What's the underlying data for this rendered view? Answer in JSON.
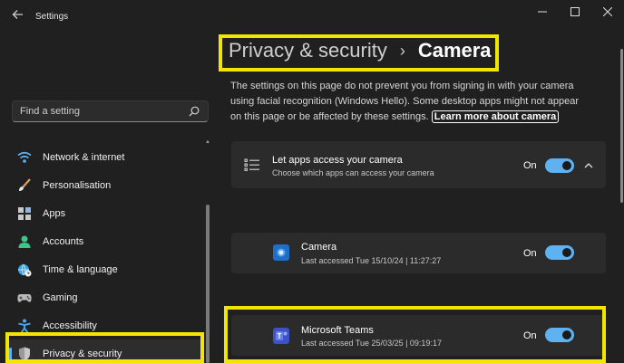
{
  "window": {
    "title": "Settings",
    "controls": {
      "minimize": "—",
      "maximize": "☐",
      "close": "✕"
    }
  },
  "search": {
    "placeholder": "Find a setting"
  },
  "sidebar": {
    "items": [
      {
        "label": "Network & internet",
        "icon": "wifi-icon"
      },
      {
        "label": "Personalisation",
        "icon": "brush-icon"
      },
      {
        "label": "Apps",
        "icon": "apps-icon"
      },
      {
        "label": "Accounts",
        "icon": "person-icon"
      },
      {
        "label": "Time & language",
        "icon": "globe-clock-icon"
      },
      {
        "label": "Gaming",
        "icon": "gamepad-icon"
      },
      {
        "label": "Accessibility",
        "icon": "accessibility-icon"
      },
      {
        "label": "Privacy & security",
        "icon": "shield-icon",
        "active": true
      }
    ]
  },
  "breadcrumb": {
    "parent": "Privacy & security",
    "separator": "›",
    "current": "Camera"
  },
  "description": {
    "text": "The settings on this page do not prevent you from signing in with your camera using facial recognition (Windows Hello). Some desktop apps might not appear on this page or be affected by these settings.",
    "link": "Learn more about camera"
  },
  "master_setting": {
    "title": "Let apps access your camera",
    "subtitle": "Choose which apps can access your camera",
    "state": "On"
  },
  "apps": [
    {
      "name": "Camera",
      "last_accessed": "Last accessed Tue 15/10/24  |  11:27:27",
      "state": "On"
    },
    {
      "name": "Microsoft Teams",
      "last_accessed": "Last accessed Tue 25/03/25  |  09:19:17",
      "state": "On"
    }
  ],
  "colors": {
    "accent": "#5fb2f2",
    "highlight": "#f2e600",
    "background": "#202020",
    "card": "#2b2b2b"
  }
}
